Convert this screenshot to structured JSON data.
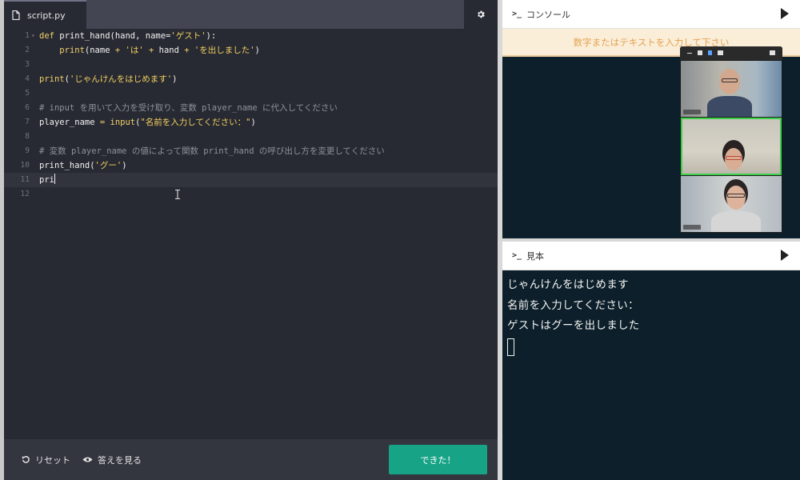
{
  "editor": {
    "tab": {
      "filename": "script.py",
      "icon": "file-icon"
    },
    "settings_icon": "gear-icon",
    "lines": [
      {
        "no": "1",
        "fold": "▾",
        "tokens": [
          [
            "kw",
            "def "
          ],
          [
            "fn",
            "print_hand(hand, name="
          ],
          [
            "str",
            "'ゲスト'"
          ],
          [
            "fn",
            "):"
          ]
        ]
      },
      {
        "no": "2",
        "tokens": [
          [
            "fn",
            "    "
          ],
          [
            "kw",
            "print"
          ],
          [
            "fn",
            "(name "
          ],
          [
            "op",
            "+ "
          ],
          [
            "str",
            "'は' "
          ],
          [
            "op",
            "+ "
          ],
          [
            "fn",
            "hand "
          ],
          [
            "op",
            "+ "
          ],
          [
            "str",
            "'を出しました'"
          ],
          [
            "fn",
            ")"
          ]
        ]
      },
      {
        "no": "3",
        "tokens": []
      },
      {
        "no": "4",
        "tokens": [
          [
            "kw",
            "print"
          ],
          [
            "fn",
            "("
          ],
          [
            "str",
            "'じゃんけんをはじめます'"
          ],
          [
            "fn",
            ")"
          ]
        ]
      },
      {
        "no": "5",
        "tokens": []
      },
      {
        "no": "6",
        "tokens": [
          [
            "cm",
            "# input を用いて入力を受け取り、変数 player_name に代入してください"
          ]
        ]
      },
      {
        "no": "7",
        "tokens": [
          [
            "fn",
            "player_name "
          ],
          [
            "op",
            "= "
          ],
          [
            "kw",
            "input"
          ],
          [
            "fn",
            "("
          ],
          [
            "str",
            "\"名前を入力してください：\""
          ],
          [
            "fn",
            ")"
          ]
        ]
      },
      {
        "no": "8",
        "tokens": []
      },
      {
        "no": "9",
        "tokens": [
          [
            "cm",
            "# 変数 player_name の値によって関数 print_hand の呼び出し方を変更してください"
          ]
        ]
      },
      {
        "no": "10",
        "tokens": [
          [
            "fn",
            "print_hand("
          ],
          [
            "str",
            "'グー'"
          ],
          [
            "fn",
            ")"
          ]
        ]
      },
      {
        "no": "11",
        "active": true,
        "caret": true,
        "tokens": [
          [
            "fn",
            "pri"
          ]
        ]
      },
      {
        "no": "12",
        "tokens": []
      }
    ]
  },
  "actions": {
    "reset_label": "リセット",
    "reset_icon": "reset-icon",
    "show_answer_label": "答えを見る",
    "show_answer_icon": "eye-icon",
    "done_label": "できた！",
    "done_color": "#17a386"
  },
  "console": {
    "title": "コンソール",
    "prompt_icon": ">_",
    "input_hint": "数字またはテキストを入力して下さい"
  },
  "sample": {
    "title": "見本",
    "prompt_icon": ">_",
    "output_lines": [
      "じゃんけんをはじめます",
      "名前を入力してください：",
      "ゲストはグーを出しました"
    ]
  },
  "video_call": {
    "participants": [
      "participant-1",
      "participant-2",
      "participant-3"
    ],
    "active_speaker_color": "#3cd04a"
  }
}
